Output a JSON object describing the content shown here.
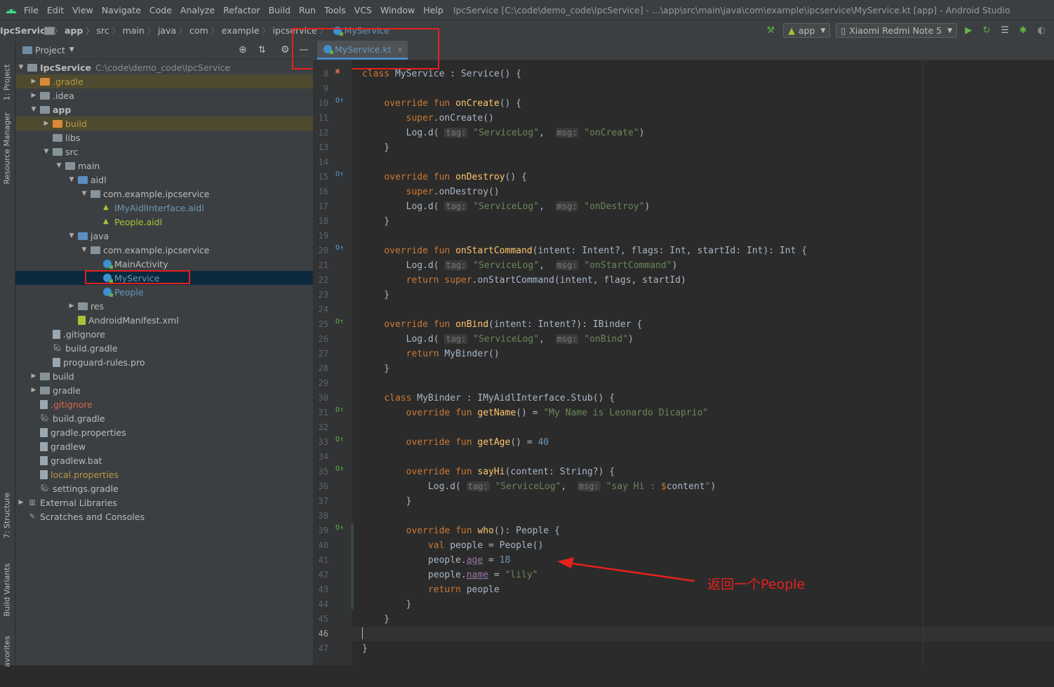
{
  "menubar": {
    "items": [
      "File",
      "Edit",
      "View",
      "Navigate",
      "Code",
      "Analyze",
      "Refactor",
      "Build",
      "Run",
      "Tools",
      "VCS",
      "Window",
      "Help"
    ],
    "title": "IpcService [C:\\code\\demo_code\\IpcService] - ...\\app\\src\\main\\java\\com\\example\\ipcservice\\MyService.kt [app] - Android Studio"
  },
  "breadcrumbs": [
    "IpcService",
    "app",
    "src",
    "main",
    "java",
    "com",
    "example",
    "ipcservice",
    "MyService"
  ],
  "toolbar": {
    "run_config": "app",
    "device": "Xiaomi Redmi Note 5"
  },
  "side_tabs": {
    "project": "1: Project",
    "resource_manager": "Resource Manager",
    "structure": "7: Structure",
    "build_variants": "Build Variants",
    "favorites": "avorites"
  },
  "project_panel": {
    "header": "Project",
    "tree": [
      {
        "label": "IpcService",
        "path": "C:\\code\\demo_code\\IpcService"
      },
      {
        "label": ".gradle"
      },
      {
        "label": ".idea"
      },
      {
        "label": "app"
      },
      {
        "label": "build"
      },
      {
        "label": "libs"
      },
      {
        "label": "src"
      },
      {
        "label": "main"
      },
      {
        "label": "aidl"
      },
      {
        "label": "com.example.ipcservice"
      },
      {
        "label": "IMyAidlInterface.aidl"
      },
      {
        "label": "People.aidl"
      },
      {
        "label": "java"
      },
      {
        "label": "com.example.ipcservice"
      },
      {
        "label": "MainActivity"
      },
      {
        "label": "MyService"
      },
      {
        "label": "People"
      },
      {
        "label": "res"
      },
      {
        "label": "AndroidManifest.xml"
      },
      {
        "label": ".gitignore"
      },
      {
        "label": "build.gradle"
      },
      {
        "label": "proguard-rules.pro"
      },
      {
        "label": "build"
      },
      {
        "label": "gradle"
      },
      {
        "label": ".gitignore"
      },
      {
        "label": "build.gradle"
      },
      {
        "label": "gradle.properties"
      },
      {
        "label": "gradlew"
      },
      {
        "label": "gradlew.bat"
      },
      {
        "label": "local.properties"
      },
      {
        "label": "settings.gradle"
      },
      {
        "label": "External Libraries"
      },
      {
        "label": "Scratches and Consoles"
      }
    ]
  },
  "editor": {
    "tab": "MyService.kt",
    "line_numbers": [
      "8",
      "9",
      "10",
      "11",
      "12",
      "13",
      "14",
      "15",
      "16",
      "17",
      "18",
      "19",
      "20",
      "21",
      "22",
      "23",
      "24",
      "25",
      "26",
      "27",
      "28",
      "29",
      "30",
      "31",
      "32",
      "33",
      "34",
      "35",
      "36",
      "37",
      "38",
      "39",
      "40",
      "41",
      "42",
      "43",
      "44",
      "45",
      "46",
      "47"
    ]
  },
  "annotation": {
    "text": "返回一个People"
  },
  "colors": {
    "accent": "#4a88c7",
    "annotation_red": "#e5211c"
  }
}
